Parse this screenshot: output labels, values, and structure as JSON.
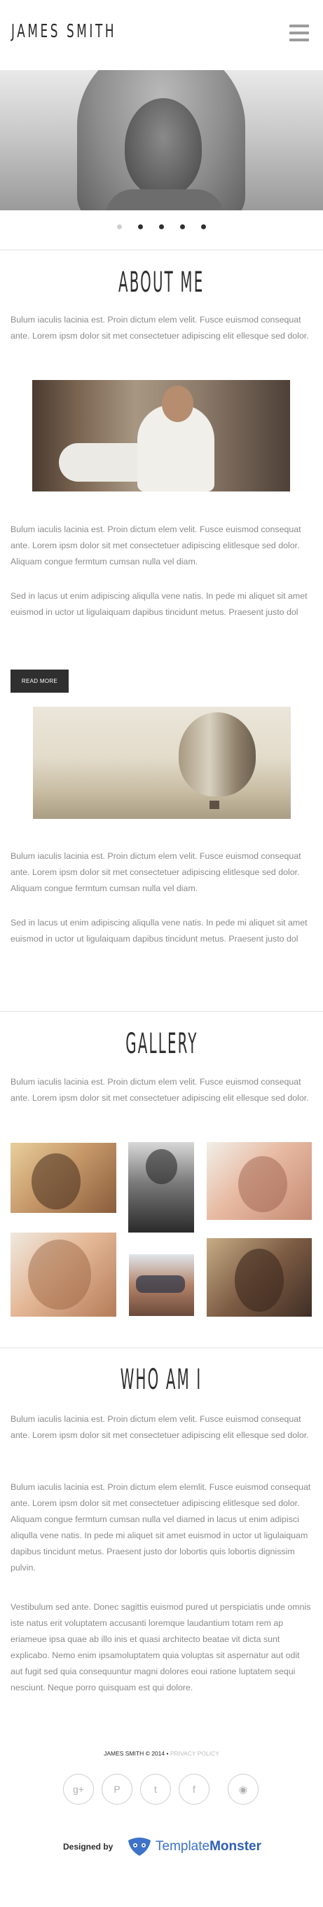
{
  "header": {
    "logo": "JAMES SMITH",
    "menu_icon": "hamburger-menu-icon"
  },
  "slider": {
    "dots_total": 5,
    "active_index": 0
  },
  "about": {
    "title": "ABOUT ME",
    "p1": "Bulum iaculis lacinia est. Proin dictum elem velit. Fusce euismod consequat ante. Lorem ipsm dolor sit met consectetuer adipiscing elit ellesque sed dolor.",
    "p2": "Bulum iaculis lacinia est. Proin dictum elem velit. Fusce euismod consequat ante. Lorem ipsm dolor sit met consectetuer adipiscing elitlesque sed dolor. Aliquam congue fermtum cumsan nulla vel diam.",
    "p3": "Sed in lacus ut enim adipiscing aliqulla vene natis. In pede mi aliquet sit amet euismod in uctor ut ligulaiquam dapibus tincidunt metus. Praesent justo dol",
    "read_more": "READ MORE",
    "p4": "Bulum iaculis lacinia est. Proin dictum elem velit. Fusce euismod consequat ante. Lorem ipsm dolor sit met consectetuer adipiscing elitlesque sed dolor. Aliquam congue fermtum cumsan nulla vel diam.",
    "p5": "Sed in lacus ut enim adipiscing aliqulla vene natis. In pede mi aliquet sit amet euismod in uctor ut ligulaiquam dapibus tincidunt metus. Praesent justo dol"
  },
  "gallery": {
    "title": "GALLERY",
    "p1": "Bulum iaculis lacinia est. Proin dictum elem velit. Fusce euismod consequat ante. Lorem ipsm dolor sit met consectetuer adipiscing elit ellesque sed dolor."
  },
  "who": {
    "title": "WHO AM I",
    "p1": "Bulum iaculis lacinia est. Proin dictum elem velit. Fusce euismod consequat ante. Lorem ipsm dolor sit met consectetuer adipiscing elit ellesque sed dolor.",
    "p2": "Bulum iaculis lacinia est. Proin dictum elem elemlit. Fusce euismod consequat ante. Lorem ipsm dolor sit met consectetuer adipiscing elitlesque sed dolor. Aliquam congue fermtum cumsan nulla vel diamed in lacus ut enim adipisci aliqulla vene natis. In pede mi aliquet sit amet euismod in uctor ut ligulaiquam dapibus tincidunt metus. Praesent justo dor lobortis quis lobortis dignissim pulvin.",
    "p3": "Vestibulum sed ante. Donec sagittis euismod pured ut perspiciatis unde omnis iste natus erit voluptatem accusanti loremque laudantium totam rem ap eriameue ipsa quae ab illo inis et quasi architecto beatae vit dicta sunt explicabo. Nemo enim ipsamoluptatem quia voluptas sit aspernatur aut odit aut fugit sed quia consequuntur magni dolores eoui ratione luptatem sequi nesciunt. Neque porro quisquam est qui dolore."
  },
  "footer": {
    "copyright": "JAMES SMITH © 2014 •",
    "privacy": "PRIVACY POLICY",
    "socials": [
      {
        "icon": "google-plus-icon",
        "glyph": "g+"
      },
      {
        "icon": "pinterest-icon",
        "glyph": "P"
      },
      {
        "icon": "twitter-icon",
        "glyph": "t"
      },
      {
        "icon": "facebook-icon",
        "glyph": "f"
      },
      {
        "icon": "rss-icon",
        "glyph": "◉"
      }
    ],
    "designed_by": "Designed by",
    "brand_part1": "Template",
    "brand_part2": "Monster"
  },
  "colors": {
    "text": "#8a8a8a",
    "heading": "#2e2e2e",
    "button_bg": "#2f2f2f",
    "brand_blue": "#3d73c8"
  }
}
